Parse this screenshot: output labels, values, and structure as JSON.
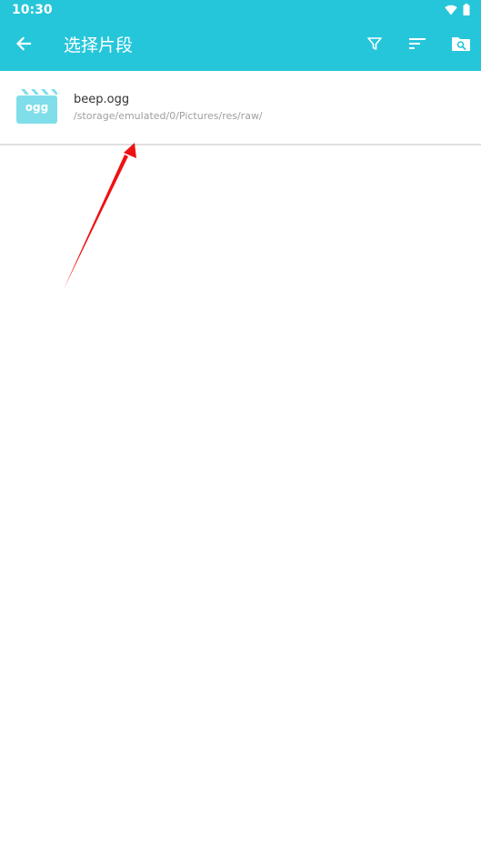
{
  "status_bar": {
    "time": "10:30",
    "icons": [
      "wifi-icon",
      "battery-icon"
    ]
  },
  "app_bar": {
    "title": "选择片段",
    "background_color": "#26c6da",
    "back_icon": "arrow-left-icon",
    "actions": [
      "filter-icon",
      "sort-icon",
      "folder-search-icon"
    ]
  },
  "files": [
    {
      "name": "beep.ogg",
      "path": "/storage/emulated/0/Pictures/res/raw/",
      "icon_label": "ogg",
      "icon_color": "#80deea"
    }
  ],
  "annotation": {
    "type": "red-arrow",
    "color": "#ee1111"
  }
}
